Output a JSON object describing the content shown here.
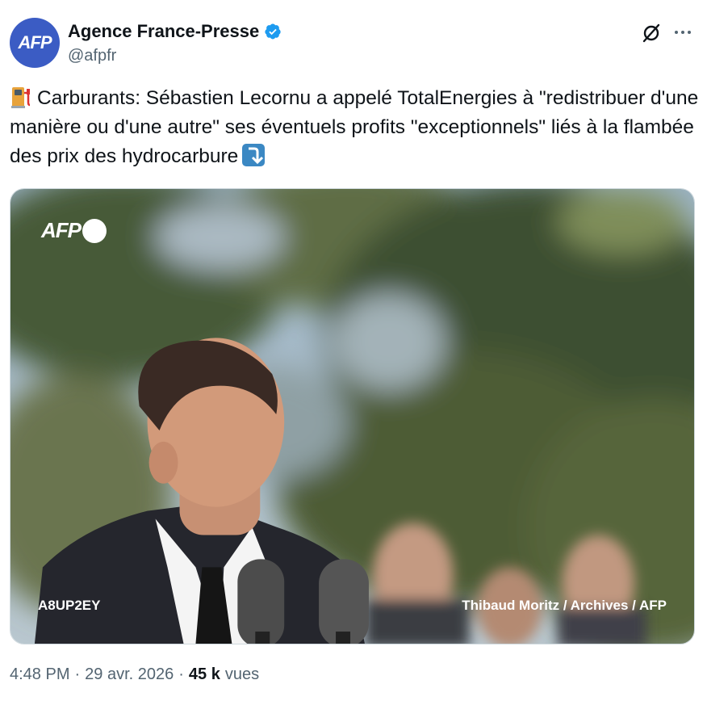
{
  "author": {
    "avatar_text": "AFP",
    "display_name": "Agence France-Presse",
    "handle": "@afpfr",
    "verified_color": "#1d9bf0",
    "avatar_color": "#3b5cc4"
  },
  "tweet": {
    "text": "Carburants: Sébastien Lecornu a appelé TotalEnergies à \"redistribuer d'une manière ou d'une autre\" ses éventuels profits \"exceptionnels\" liés à la flambée des prix des hydrocarbure",
    "leading_icon": "fuel-pump-icon",
    "trailing_icon": "arrow-down-right-icon"
  },
  "media": {
    "watermark": "AFP",
    "photo_id": "A8UP2EY",
    "credit": "Thibaud Moritz / Archives / AFP"
  },
  "meta": {
    "time": "4:48 PM",
    "separator": "·",
    "date": "29 avr. 2026",
    "views_count": "45 k",
    "views_label": "vues"
  },
  "icons": {
    "grok": "grok-icon",
    "more": "more-options-icon"
  }
}
